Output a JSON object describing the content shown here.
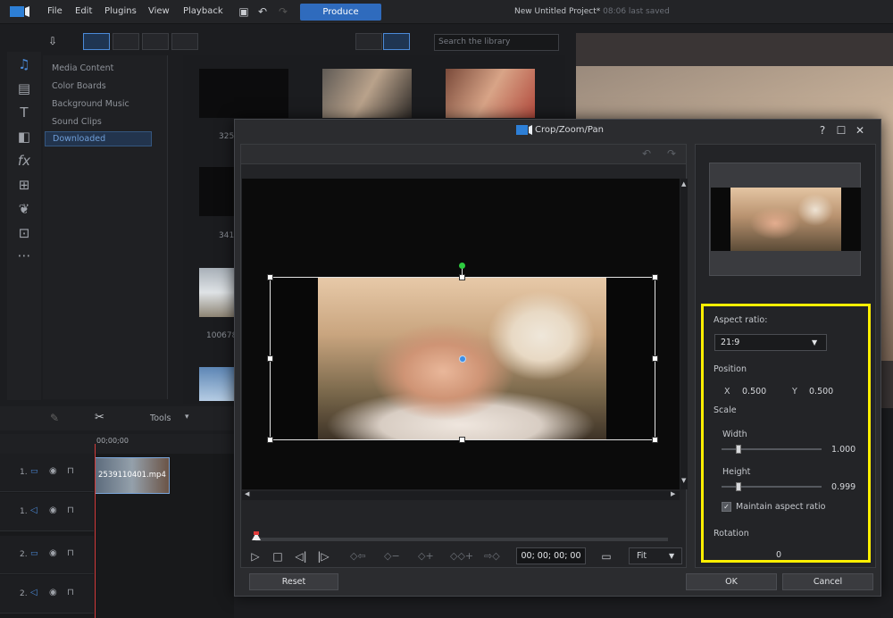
{
  "menu": {
    "items": [
      "File",
      "Edit",
      "Plugins",
      "View",
      "Playback"
    ],
    "produce_label": "Produce",
    "project_title": "New Untitled Project*",
    "last_saved": "08:06 last saved"
  },
  "library": {
    "search_placeholder": "Search the library",
    "tree": [
      "Media Content",
      "Color Boards",
      "Background Music",
      "Sound Clips",
      "Downloaded"
    ],
    "thumb_labels": [
      "325",
      "341",
      "100678"
    ]
  },
  "timeline": {
    "tools_label": "Tools",
    "timecode": "00;00;00",
    "tracks": [
      "1.",
      "1.",
      "2.",
      "2."
    ],
    "clip_name": "2539110401.mp4"
  },
  "dialog": {
    "title": "Crop/Zoom/Pan",
    "timecode": "00; 00; 00; 00",
    "fit_label": "Fit",
    "reset_label": "Reset",
    "ok_label": "OK",
    "cancel_label": "Cancel",
    "props": {
      "aspect_ratio_label": "Aspect ratio:",
      "aspect_ratio_value": "21:9",
      "position_label": "Position",
      "x_label": "X",
      "x_value": "0.500",
      "y_label": "Y",
      "y_value": "0.500",
      "scale_label": "Scale",
      "width_label": "Width",
      "width_value": "1.000",
      "height_label": "Height",
      "height_value": "0.999",
      "maintain_label": "Maintain aspect ratio",
      "rotation_label": "Rotation",
      "rotation_value": "0"
    }
  },
  "colors": {
    "accent": "#2f6bbd",
    "highlight": "#ffef00",
    "center_handle": "#3b8ee6",
    "rotate_handle": "#2ecc40"
  }
}
